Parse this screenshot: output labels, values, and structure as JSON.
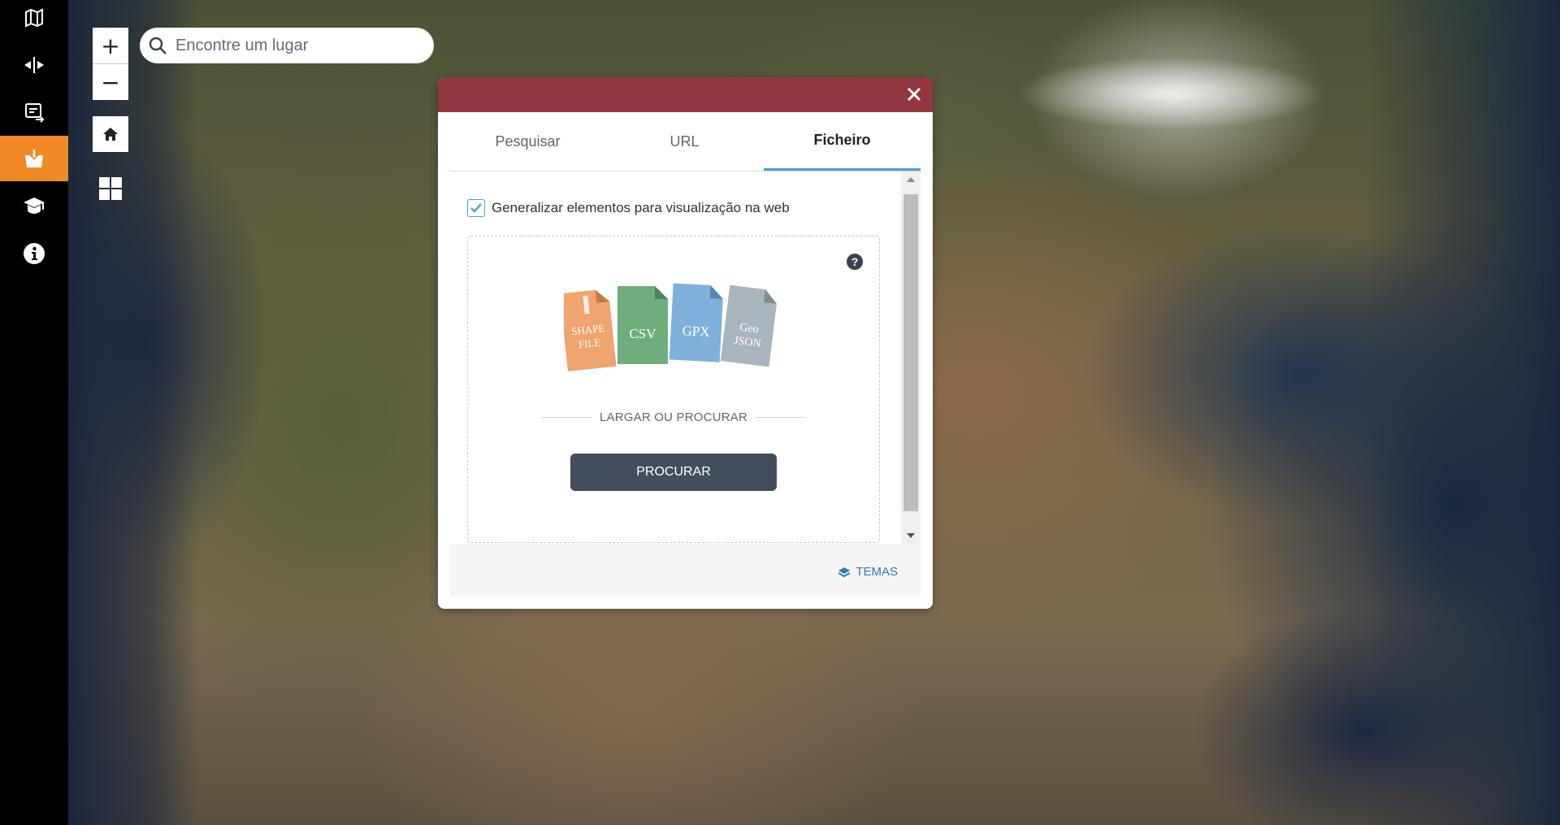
{
  "sidebar": {
    "items": [
      {
        "icon": "map-gallery-icon"
      },
      {
        "icon": "compare-icon"
      },
      {
        "icon": "print-export-icon"
      },
      {
        "icon": "add-data-icon",
        "active": true
      },
      {
        "icon": "education-icon"
      },
      {
        "icon": "info-icon"
      }
    ],
    "active_color": "#f08a24"
  },
  "map_controls": {
    "zoom_in_symbol": "+",
    "zoom_out_symbol": "−"
  },
  "search": {
    "placeholder": "Encontre um lugar",
    "value": ""
  },
  "dialog": {
    "header_color": "#923641",
    "tabs": [
      {
        "label": "Pesquisar",
        "active": false
      },
      {
        "label": "URL",
        "active": false
      },
      {
        "label": "Ficheiro",
        "active": true
      }
    ],
    "generalize": {
      "label": "Generalizar elementos para visualização na web",
      "checked": true
    },
    "file_types": [
      "SHAPE FILE",
      "CSV",
      "GPX",
      "Geo JSON"
    ],
    "drop_text": "LARGAR OU PROCURAR",
    "browse_label": "PROCURAR",
    "footer_link": "TEMAS",
    "accent_color": "#4aa3c9"
  }
}
